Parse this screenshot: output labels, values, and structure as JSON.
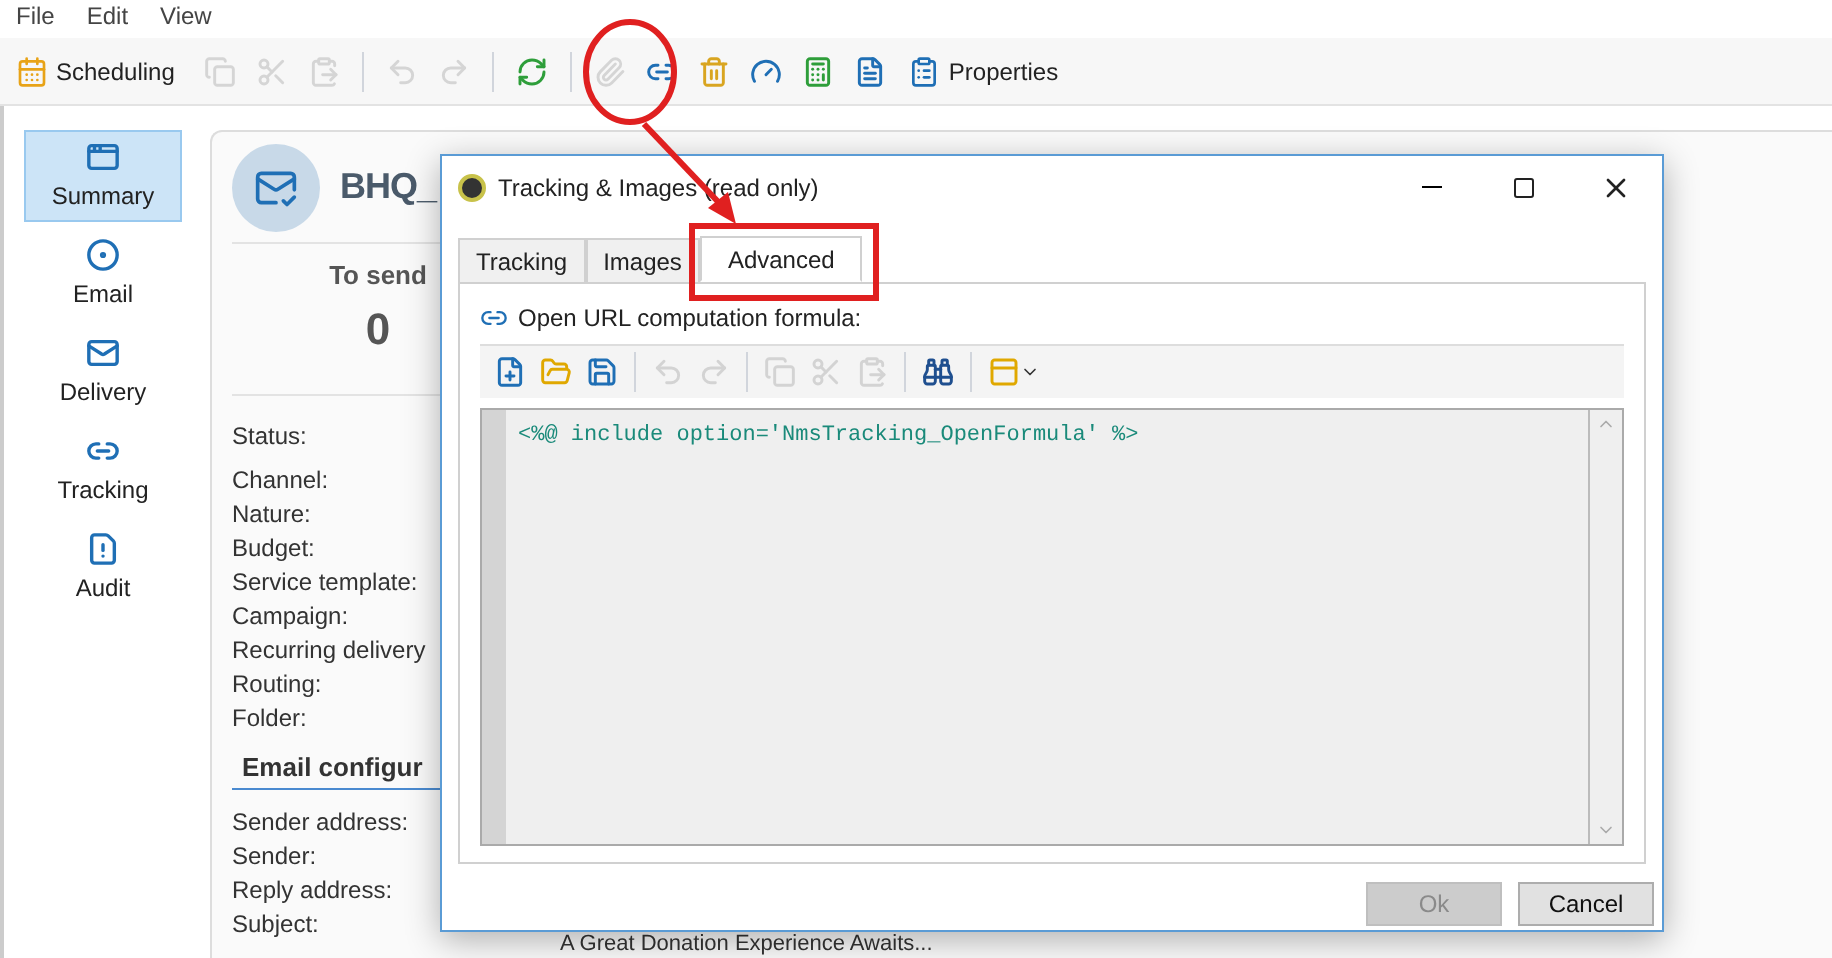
{
  "menu": [
    "File",
    "Edit",
    "View"
  ],
  "toolbar": {
    "scheduling": "Scheduling",
    "properties": "Properties",
    "tools": [
      {
        "kind": "copy",
        "disabled": true
      },
      {
        "kind": "cut",
        "disabled": true
      },
      {
        "kind": "paste",
        "disabled": true
      },
      {
        "kind": "sep"
      },
      {
        "kind": "undo",
        "disabled": true
      },
      {
        "kind": "redo",
        "disabled": true
      },
      {
        "kind": "sep"
      },
      {
        "kind": "refresh",
        "disabled": false
      },
      {
        "kind": "sep"
      },
      {
        "kind": "attach",
        "disabled": true
      },
      {
        "kind": "tracking",
        "disabled": false
      },
      {
        "kind": "bin",
        "disabled": false
      },
      {
        "kind": "gauge",
        "disabled": false
      },
      {
        "kind": "calc",
        "disabled": false
      },
      {
        "kind": "doc",
        "disabled": false
      }
    ]
  },
  "sidebar": {
    "items": [
      {
        "kind": "summary",
        "label": "Summary",
        "selected": true
      },
      {
        "kind": "email",
        "label": "Email",
        "selected": false
      },
      {
        "kind": "delivery",
        "label": "Delivery",
        "selected": false
      },
      {
        "kind": "tracking",
        "label": "Tracking",
        "selected": false
      },
      {
        "kind": "audit",
        "label": "Audit",
        "selected": false
      }
    ]
  },
  "delivery": {
    "title": "BHQ_",
    "to_send_label": "To send",
    "to_send_value": "0",
    "fields": [
      "Status:",
      "Channel:",
      "Nature:",
      "Budget:",
      "Service template:",
      "Campaign:",
      "Recurring delivery",
      "Routing:",
      "Folder:"
    ],
    "section": "Email configur",
    "email_fields": [
      "Sender address:",
      "Sender:",
      "Reply address:",
      "Subject:"
    ],
    "subject_value": "A Great Donation Experience Awaits..."
  },
  "dialog": {
    "title": "Tracking & Images (read only)",
    "tabs": [
      {
        "label": "Tracking",
        "selected": false
      },
      {
        "label": "Images",
        "selected": false
      },
      {
        "label": "Advanced",
        "selected": true
      }
    ],
    "formula_label": "Open URL computation formula:",
    "editor_tools": [
      {
        "kind": "new",
        "disabled": false
      },
      {
        "kind": "open",
        "disabled": false
      },
      {
        "kind": "save",
        "disabled": false
      },
      {
        "kind": "sep"
      },
      {
        "kind": "undo",
        "disabled": true
      },
      {
        "kind": "redo",
        "disabled": true
      },
      {
        "kind": "sep"
      },
      {
        "kind": "copy",
        "disabled": true
      },
      {
        "kind": "cut",
        "disabled": true
      },
      {
        "kind": "paste",
        "disabled": true
      },
      {
        "kind": "sep"
      },
      {
        "kind": "find",
        "disabled": false
      },
      {
        "kind": "sep"
      },
      {
        "kind": "template",
        "disabled": false
      }
    ],
    "code": "<%@ include option='NmsTracking_OpenFormula' %>",
    "buttons": [
      {
        "label": "Ok",
        "disabled": true
      },
      {
        "label": "Cancel",
        "disabled": false
      }
    ]
  }
}
